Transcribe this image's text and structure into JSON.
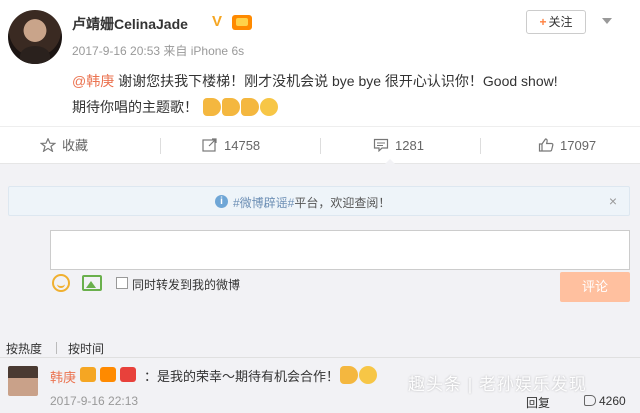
{
  "post": {
    "username": "卢靖姗CelinaJade",
    "verified_badge": "V",
    "meta": "2017-9-16 20:53 来自 iPhone 6s",
    "follow_label": "关注",
    "follow_prefix": "+",
    "mention": "@韩庚",
    "text_line1": " 谢谢您扶我下楼梯！刚才没机会说 bye bye 很开心认识你！Good show!",
    "text_line2": "期待你唱的主题歌！"
  },
  "actions": {
    "favorite_label": "收藏",
    "repost_count": "14758",
    "comment_count": "1281",
    "like_count": "17097"
  },
  "notice": {
    "icon": "i",
    "tag": "#微博辟谣#",
    "text": "平台，欢迎查阅！",
    "close": "×"
  },
  "comment_box": {
    "repost_label": "同时转发到我的微博",
    "submit_label": "评论"
  },
  "sort": {
    "hot_label": "按热度",
    "time_label": "按时间"
  },
  "reply": {
    "name": "韩庚",
    "text": "：是我的荣幸～期待有机会合作！",
    "time": "2017-9-16 22:13",
    "reply_label": "回复",
    "like_count": "4260"
  },
  "watermark": "趣头条 | 老孙娱乐发现",
  "colors": {
    "accent_orange": "#eb7350",
    "submit_disabled": "#ffc09f",
    "panel_bg": "#f2f2f5",
    "notice_bg": "#eef4f9"
  }
}
